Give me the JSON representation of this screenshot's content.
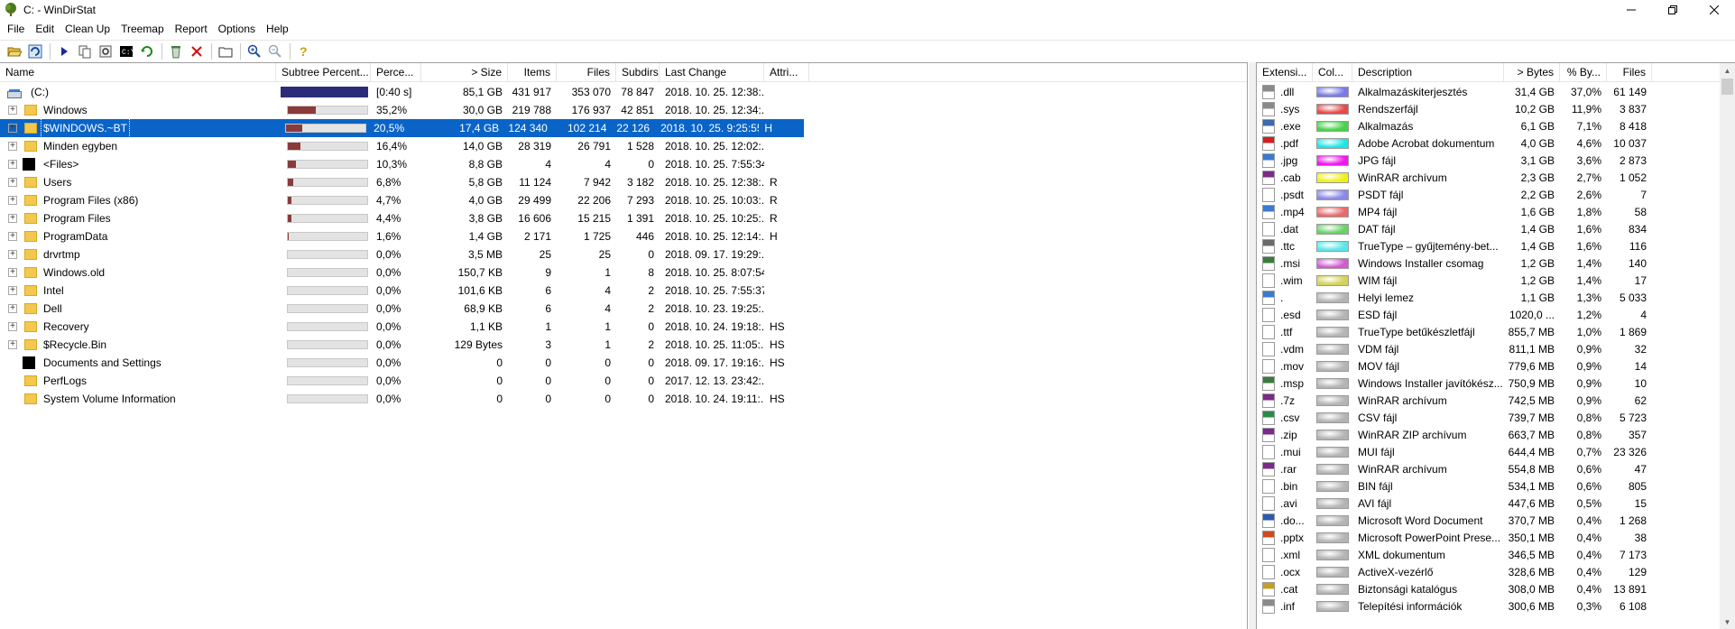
{
  "window": {
    "title": "C: - WinDirStat"
  },
  "menu": [
    "File",
    "Edit",
    "Clean Up",
    "Treemap",
    "Report",
    "Options",
    "Help"
  ],
  "toolbar_icons": [
    "open-icon",
    "refresh-all-icon",
    "play-icon",
    "copy-icon",
    "explorer-icon",
    "cmd-icon",
    "refresh-icon",
    "recycle-icon",
    "delete-icon",
    "folder-icon",
    "zoom-in-icon",
    "zoom-out-icon",
    "help-icon"
  ],
  "tree": {
    "columns": [
      "Name",
      "Subtree Percent...",
      "Perce...",
      "> Size",
      "Items",
      "Files",
      "Subdirs",
      "Last Change",
      "Attri..."
    ],
    "rows": [
      {
        "name": "(C:)",
        "icon": "drive-icon",
        "expand": "",
        "pct": "[0:40 s]",
        "size": "85,1 GB",
        "items": "431 917",
        "files": "353 070",
        "subdirs": "78 847",
        "change": "2018. 10. 25.  12:38:...",
        "attr": "",
        "bar": 1.0,
        "root": true
      },
      {
        "name": "Windows",
        "icon": "folder-icon",
        "expand": "+",
        "pct": "35,2%",
        "size": "30,0 GB",
        "items": "219 788",
        "files": "176 937",
        "subdirs": "42 851",
        "change": "2018. 10. 25.  12:34:...",
        "attr": "",
        "bar": 0.352
      },
      {
        "name": "$WINDOWS.~BT",
        "icon": "folder-icon",
        "expand": "+",
        "pct": "20,5%",
        "size": "17,4 GB",
        "items": "124 340",
        "files": "102 214",
        "subdirs": "22 126",
        "change": "2018. 10. 25.  9:25:55",
        "attr": "H",
        "bar": 0.205,
        "selected": true
      },
      {
        "name": "Minden egyben",
        "icon": "folder-icon",
        "expand": "+",
        "pct": "16,4%",
        "size": "14,0 GB",
        "items": "28 319",
        "files": "26 791",
        "subdirs": "1 528",
        "change": "2018. 10. 25.  12:02:...",
        "attr": "",
        "bar": 0.164
      },
      {
        "name": "<Files>",
        "icon": "files-icon",
        "expand": "+",
        "pct": "10,3%",
        "size": "8,8 GB",
        "items": "4",
        "files": "4",
        "subdirs": "0",
        "change": "2018. 10. 25.  7:55:34",
        "attr": "",
        "bar": 0.103
      },
      {
        "name": "Users",
        "icon": "folder-icon",
        "expand": "+",
        "pct": "6,8%",
        "size": "5,8 GB",
        "items": "11 124",
        "files": "7 942",
        "subdirs": "3 182",
        "change": "2018. 10. 25.  12:38:...",
        "attr": "R",
        "bar": 0.068
      },
      {
        "name": "Program Files (x86)",
        "icon": "folder-icon",
        "expand": "+",
        "pct": "4,7%",
        "size": "4,0 GB",
        "items": "29 499",
        "files": "22 206",
        "subdirs": "7 293",
        "change": "2018. 10. 25.  10:03:...",
        "attr": "R",
        "bar": 0.047
      },
      {
        "name": "Program Files",
        "icon": "folder-icon",
        "expand": "+",
        "pct": "4,4%",
        "size": "3,8 GB",
        "items": "16 606",
        "files": "15 215",
        "subdirs": "1 391",
        "change": "2018. 10. 25.  10:25:...",
        "attr": "R",
        "bar": 0.044
      },
      {
        "name": "ProgramData",
        "icon": "folder-icon",
        "expand": "+",
        "pct": "1,6%",
        "size": "1,4 GB",
        "items": "2 171",
        "files": "1 725",
        "subdirs": "446",
        "change": "2018. 10. 25.  12:14:...",
        "attr": "H",
        "bar": 0.016
      },
      {
        "name": "drvrtmp",
        "icon": "folder-icon",
        "expand": "+",
        "pct": "0,0%",
        "size": "3,5 MB",
        "items": "25",
        "files": "25",
        "subdirs": "0",
        "change": "2018. 09. 17.  19:29:...",
        "attr": "",
        "bar": 0.0
      },
      {
        "name": "Windows.old",
        "icon": "folder-icon",
        "expand": "+",
        "pct": "0,0%",
        "size": "150,7 KB",
        "items": "9",
        "files": "1",
        "subdirs": "8",
        "change": "2018. 10. 25.  8:07:54",
        "attr": "",
        "bar": 0.0
      },
      {
        "name": "Intel",
        "icon": "folder-icon",
        "expand": "+",
        "pct": "0,0%",
        "size": "101,6 KB",
        "items": "6",
        "files": "4",
        "subdirs": "2",
        "change": "2018. 10. 25.  7:55:37",
        "attr": "",
        "bar": 0.0
      },
      {
        "name": "Dell",
        "icon": "folder-icon",
        "expand": "+",
        "pct": "0,0%",
        "size": "68,9 KB",
        "items": "6",
        "files": "4",
        "subdirs": "2",
        "change": "2018. 10. 23.  19:25:...",
        "attr": "",
        "bar": 0.0
      },
      {
        "name": "Recovery",
        "icon": "folder-icon",
        "expand": "+",
        "pct": "0,0%",
        "size": "1,1 KB",
        "items": "1",
        "files": "1",
        "subdirs": "0",
        "change": "2018. 10. 24.  19:18:...",
        "attr": "HS",
        "bar": 0.0
      },
      {
        "name": "$Recycle.Bin",
        "icon": "folder-icon",
        "expand": "+",
        "pct": "0,0%",
        "size": "129 Bytes",
        "items": "3",
        "files": "1",
        "subdirs": "2",
        "change": "2018. 10. 25.  11:05:...",
        "attr": "HS",
        "bar": 0.0
      },
      {
        "name": "Documents and Settings",
        "icon": "junction-icon",
        "expand": "",
        "pct": "0,0%",
        "size": "0",
        "items": "0",
        "files": "0",
        "subdirs": "0",
        "change": "2018. 09. 17.  19:16:...",
        "attr": "HS",
        "bar": 0.0
      },
      {
        "name": "PerfLogs",
        "icon": "folder-icon",
        "expand": "",
        "pct": "0,0%",
        "size": "0",
        "items": "0",
        "files": "0",
        "subdirs": "0",
        "change": "2017. 12. 13.  23:42:...",
        "attr": "",
        "bar": 0.0
      },
      {
        "name": "System Volume Information",
        "icon": "folder-icon",
        "expand": "",
        "pct": "0,0%",
        "size": "0",
        "items": "0",
        "files": "0",
        "subdirs": "0",
        "change": "2018. 10. 24.  19:11:...",
        "attr": "HS",
        "bar": 0.0
      }
    ]
  },
  "extensions": {
    "columns": [
      "Extensi...",
      "Col...",
      "Description",
      "> Bytes",
      "% By...",
      "Files"
    ],
    "rows": [
      {
        "ext": ".dll",
        "color": "#7a7ae6",
        "desc": "Alkalmazáskiterjesztés",
        "bytes": "31,4 GB",
        "pct": "37,0%",
        "files": "61 149",
        "icon": "dll-icon"
      },
      {
        "ext": ".sys",
        "color": "#e64a4a",
        "desc": "Rendszerfájl",
        "bytes": "10,2 GB",
        "pct": "11,9%",
        "files": "3 837",
        "icon": "sys-icon"
      },
      {
        "ext": ".exe",
        "color": "#4ad24a",
        "desc": "Alkalmazás",
        "bytes": "6,1 GB",
        "pct": "7,1%",
        "files": "8 418",
        "icon": "exe-icon"
      },
      {
        "ext": ".pdf",
        "color": "#1ee6e6",
        "desc": "Adobe Acrobat dokumentum",
        "bytes": "4,0 GB",
        "pct": "4,6%",
        "files": "10 037",
        "icon": "pdf-icon"
      },
      {
        "ext": ".jpg",
        "color": "#ee18ee",
        "desc": "JPG fájl",
        "bytes": "3,1 GB",
        "pct": "3,6%",
        "files": "2 873",
        "icon": "jpg-icon"
      },
      {
        "ext": ".cab",
        "color": "#f0f018",
        "desc": "WinRAR archívum",
        "bytes": "2,3 GB",
        "pct": "2,7%",
        "files": "1 052",
        "icon": "winrar-icon"
      },
      {
        "ext": ".psdt",
        "color": "#8a8ae6",
        "desc": "PSDT fájl",
        "bytes": "2,2 GB",
        "pct": "2,6%",
        "files": "7",
        "icon": "file-icon"
      },
      {
        "ext": ".mp4",
        "color": "#e66a6a",
        "desc": "MP4 fájl",
        "bytes": "1,6 GB",
        "pct": "1,8%",
        "files": "58",
        "icon": "mp4-icon"
      },
      {
        "ext": ".dat",
        "color": "#6ad26a",
        "desc": "DAT fájl",
        "bytes": "1,4 GB",
        "pct": "1,6%",
        "files": "834",
        "icon": "file-icon"
      },
      {
        "ext": ".ttc",
        "color": "#5ae6e6",
        "desc": "TrueType – gyűjtemény-bet...",
        "bytes": "1,4 GB",
        "pct": "1,6%",
        "files": "116",
        "icon": "font-icon"
      },
      {
        "ext": ".msi",
        "color": "#d25ad2",
        "desc": "Windows Installer csomag",
        "bytes": "1,2 GB",
        "pct": "1,4%",
        "files": "140",
        "icon": "msi-icon"
      },
      {
        "ext": ".wim",
        "color": "#d2d25a",
        "desc": "WIM fájl",
        "bytes": "1,2 GB",
        "pct": "1,4%",
        "files": "17",
        "icon": "file-icon"
      },
      {
        "ext": ".",
        "color": "#b4b4b4",
        "desc": "Helyi lemez",
        "bytes": "1,1 GB",
        "pct": "1,3%",
        "files": "5 033",
        "icon": "drive-icon"
      },
      {
        "ext": ".esd",
        "color": "#b4b4b4",
        "desc": "ESD fájl",
        "bytes": "1020,0 ...",
        "pct": "1,2%",
        "files": "4",
        "icon": "file-icon"
      },
      {
        "ext": ".ttf",
        "color": "#b4b4b4",
        "desc": "TrueType betűkészletfájl",
        "bytes": "855,7 MB",
        "pct": "1,0%",
        "files": "1 869",
        "icon": "file-icon"
      },
      {
        "ext": ".vdm",
        "color": "#b4b4b4",
        "desc": "VDM fájl",
        "bytes": "811,1 MB",
        "pct": "0,9%",
        "files": "32",
        "icon": "file-icon"
      },
      {
        "ext": ".mov",
        "color": "#b4b4b4",
        "desc": "MOV fájl",
        "bytes": "779,6 MB",
        "pct": "0,9%",
        "files": "14",
        "icon": "file-icon"
      },
      {
        "ext": ".msp",
        "color": "#b4b4b4",
        "desc": "Windows Installer javítókész...",
        "bytes": "750,9 MB",
        "pct": "0,9%",
        "files": "10",
        "icon": "msi-icon"
      },
      {
        "ext": ".7z",
        "color": "#b4b4b4",
        "desc": "WinRAR archívum",
        "bytes": "742,5 MB",
        "pct": "0,9%",
        "files": "62",
        "icon": "winrar-icon"
      },
      {
        "ext": ".csv",
        "color": "#b4b4b4",
        "desc": "CSV fájl",
        "bytes": "739,7 MB",
        "pct": "0,8%",
        "files": "5 723",
        "icon": "csv-icon"
      },
      {
        "ext": ".zip",
        "color": "#b4b4b4",
        "desc": "WinRAR ZIP archívum",
        "bytes": "663,7 MB",
        "pct": "0,8%",
        "files": "357",
        "icon": "winrar-icon"
      },
      {
        "ext": ".mui",
        "color": "#b4b4b4",
        "desc": "MUI fájl",
        "bytes": "644,4 MB",
        "pct": "0,7%",
        "files": "23 326",
        "icon": "file-icon"
      },
      {
        "ext": ".rar",
        "color": "#b4b4b4",
        "desc": "WinRAR archívum",
        "bytes": "554,8 MB",
        "pct": "0,6%",
        "files": "47",
        "icon": "winrar-icon"
      },
      {
        "ext": ".bin",
        "color": "#b4b4b4",
        "desc": "BIN fájl",
        "bytes": "534,1 MB",
        "pct": "0,6%",
        "files": "805",
        "icon": "file-icon"
      },
      {
        "ext": ".avi",
        "color": "#b4b4b4",
        "desc": "AVI fájl",
        "bytes": "447,6 MB",
        "pct": "0,5%",
        "files": "15",
        "icon": "file-icon"
      },
      {
        "ext": ".do...",
        "color": "#b4b4b4",
        "desc": "Microsoft Word Document",
        "bytes": "370,7 MB",
        "pct": "0,4%",
        "files": "1 268",
        "icon": "word-icon"
      },
      {
        "ext": ".pptx",
        "color": "#b4b4b4",
        "desc": "Microsoft PowerPoint Prese...",
        "bytes": "350,1 MB",
        "pct": "0,4%",
        "files": "38",
        "icon": "ppt-icon"
      },
      {
        "ext": ".xml",
        "color": "#b4b4b4",
        "desc": "XML dokumentum",
        "bytes": "346,5 MB",
        "pct": "0,4%",
        "files": "7 173",
        "icon": "file-icon"
      },
      {
        "ext": ".ocx",
        "color": "#b4b4b4",
        "desc": "ActiveX-vezérlő",
        "bytes": "328,6 MB",
        "pct": "0,4%",
        "files": "129",
        "icon": "file-icon"
      },
      {
        "ext": ".cat",
        "color": "#b4b4b4",
        "desc": "Biztonsági katalógus",
        "bytes": "308,0 MB",
        "pct": "0,4%",
        "files": "13 891",
        "icon": "cat-icon"
      },
      {
        "ext": ".inf",
        "color": "#b4b4b4",
        "desc": "Telepítési információk",
        "bytes": "300,6 MB",
        "pct": "0,3%",
        "files": "6 108",
        "icon": "inf-icon"
      }
    ]
  }
}
